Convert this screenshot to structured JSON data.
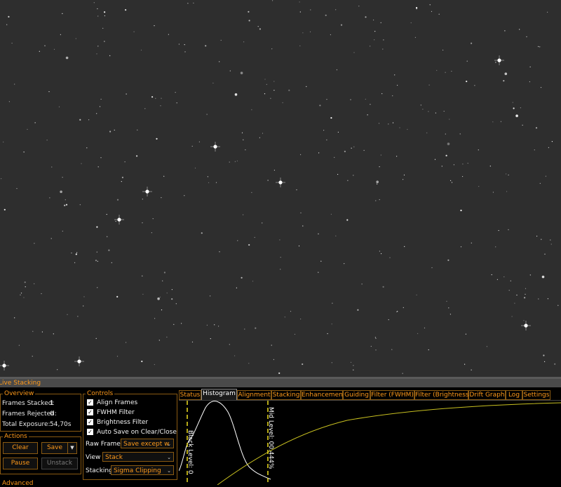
{
  "panel": {
    "title": "Live Stacking"
  },
  "overview": {
    "title": "Overview",
    "items": [
      {
        "label": "Frames Stacked:",
        "value": "1"
      },
      {
        "label": "Frames Rejected:",
        "value": "0"
      },
      {
        "label": "Total Exposure:",
        "value": "54,70s"
      }
    ]
  },
  "actions": {
    "title": "Actions",
    "clear": "Clear",
    "save": "Save",
    "pause": "Pause",
    "unstack": "Unstack",
    "next_title": "Advanced"
  },
  "controls": {
    "title": "Controls",
    "checks": [
      {
        "label": "Align Frames",
        "checked": true
      },
      {
        "label": "FWHM Filter",
        "checked": true
      },
      {
        "label": "Brightness Filter",
        "checked": true
      },
      {
        "label": "Auto Save on Clear/Close",
        "checked": true
      }
    ],
    "raw_frames_label": "Raw Frames",
    "raw_frames_value": "Save except w",
    "view_label": "View",
    "view_value": "Stack",
    "stacking_label": "Stacking",
    "stacking_value": "Sigma Clipping"
  },
  "tabs": [
    "Status",
    "Histogram",
    "Alignment",
    "Stacking",
    "Enhancement",
    "Guiding",
    "Filter (FWHM)",
    "Filter (Brightness)",
    "Drift Graph",
    "Log",
    "Settings"
  ],
  "active_tab": "Histogram",
  "histogram": {
    "black_level_label": "Black Level: 0",
    "mid_level_label": "Mid Level: 00.444%",
    "curve_color": "#ffffff",
    "stretch_color": "#c8c020",
    "marker_color": "#f0e020"
  },
  "colors": {
    "accent": "#ff9a1a",
    "border": "#8a5a12",
    "sky": "#2e2e2e"
  }
}
